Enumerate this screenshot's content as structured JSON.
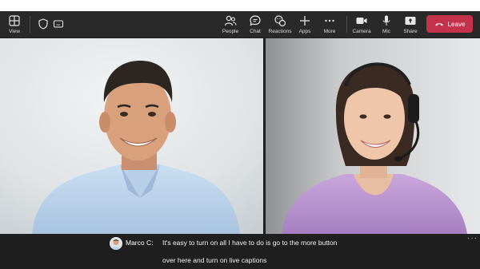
{
  "toolbar": {
    "view_label": "View",
    "people_label": "People",
    "chat_label": "Chat",
    "reactions_label": "Reactions",
    "apps_label": "Apps",
    "more_label": "More",
    "camera_label": "Camera",
    "mic_label": "Mic",
    "share_label": "Share",
    "leave_label": "Leave"
  },
  "captions": {
    "speaker": "Marco C:",
    "line1": "It's easy to turn on all I have to do is go to the more button",
    "line2": "over here and turn on live captions",
    "more_icon": "···"
  },
  "colors": {
    "leave": "#c4314b",
    "toolbar_bg": "#292929",
    "caption_bg": "#1f1f1f"
  }
}
